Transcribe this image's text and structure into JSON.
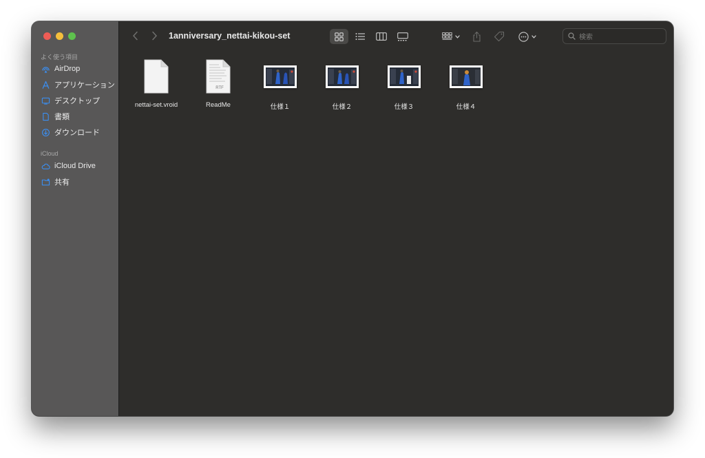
{
  "window": {
    "title": "1anniversary_nettai-kikou-set"
  },
  "sidebar": {
    "favorites_header": "よく使う項目",
    "favorites": [
      {
        "label": "AirDrop",
        "icon": "airdrop-icon"
      },
      {
        "label": "アプリケーション",
        "icon": "applications-icon"
      },
      {
        "label": "デスクトップ",
        "icon": "desktop-icon"
      },
      {
        "label": "書類",
        "icon": "documents-icon"
      },
      {
        "label": "ダウンロード",
        "icon": "downloads-icon"
      }
    ],
    "icloud_header": "iCloud",
    "icloud": [
      {
        "label": "iCloud Drive",
        "icon": "icloud-drive-icon"
      },
      {
        "label": "共有",
        "icon": "shared-folder-icon"
      }
    ]
  },
  "toolbar": {
    "search_placeholder": "検索"
  },
  "files": [
    {
      "name": "nettai-set.vroid",
      "kind": "generic-document"
    },
    {
      "name": "ReadMe",
      "kind": "rtf-document",
      "badge": "RTF"
    },
    {
      "name": "仕様１",
      "kind": "image"
    },
    {
      "name": "仕様２",
      "kind": "image"
    },
    {
      "name": "仕様３",
      "kind": "image"
    },
    {
      "name": "仕様４",
      "kind": "image"
    }
  ],
  "colors": {
    "sidebar_icon": "#3b8ef0",
    "window_bg": "#2e2d2b",
    "sidebar_bg": "#585757"
  }
}
